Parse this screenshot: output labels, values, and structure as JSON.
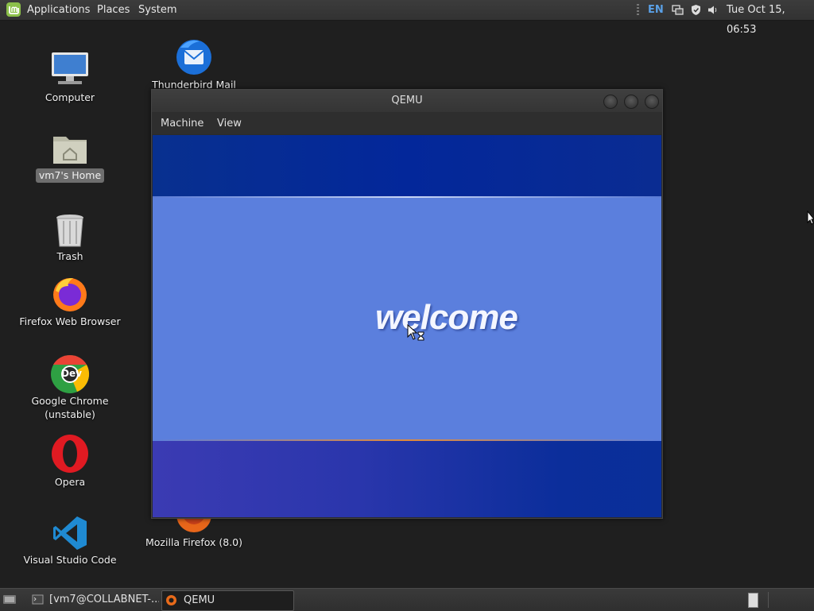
{
  "top_panel": {
    "menus": [
      "Applications",
      "Places",
      "System"
    ],
    "keyboard_layout": "EN",
    "clock": "Tue Oct 15, 06:53"
  },
  "desktop": {
    "icons": [
      {
        "label": "Computer",
        "icon": "computer-icon"
      },
      {
        "label": "vm7's Home",
        "icon": "home-folder-icon"
      },
      {
        "label": "Trash",
        "icon": "trash-icon"
      },
      {
        "label": "Firefox Web Browser",
        "icon": "firefox-icon"
      },
      {
        "label": "Google Chrome\n(unstable)",
        "label_line1": "Google Chrome",
        "label_line2": "(unstable)",
        "icon": "chrome-dev-icon",
        "badge": "Dev"
      },
      {
        "label": "Opera",
        "icon": "opera-icon"
      },
      {
        "label": "Visual Studio Code",
        "icon": "vscode-icon"
      },
      {
        "label": "Thunderbird Mail",
        "icon": "thunderbird-icon"
      },
      {
        "label": "Mozilla Firefox (8.0)",
        "icon": "firefox-old-icon"
      }
    ]
  },
  "window": {
    "title": "QEMU",
    "menu": [
      "Machine",
      "View"
    ],
    "screen_text": "welcome"
  },
  "taskbar": {
    "tasks": [
      {
        "label": "[vm7@COLLABNET-...",
        "icon": "terminal-icon",
        "active": false
      },
      {
        "label": "QEMU",
        "icon": "qemu-icon",
        "active": true
      }
    ]
  },
  "colors": {
    "welcome_band": "#5b7fdd",
    "top_band": "#03279a",
    "panel": "#363636"
  }
}
